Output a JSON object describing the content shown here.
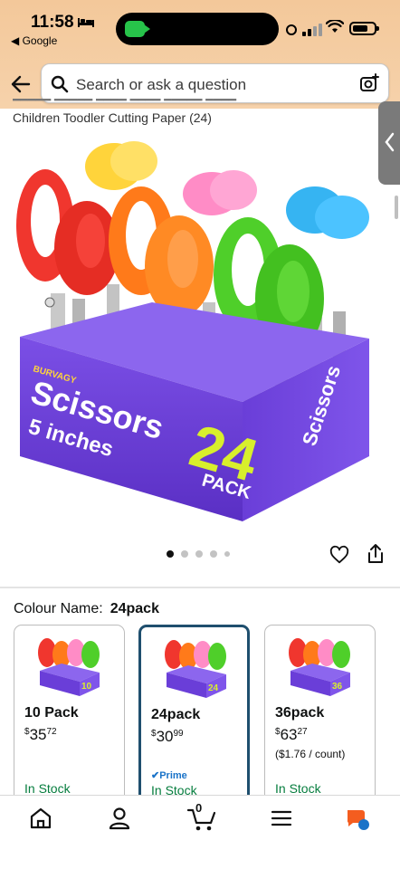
{
  "status": {
    "time": "11:58",
    "back_app": "◀ Google"
  },
  "search": {
    "placeholder": "Search or ask a question"
  },
  "product": {
    "title_partial": "Children Toodler Cutting Paper (24)",
    "image": {
      "box_brand": "BURVAGY",
      "box_title": "Scissors",
      "box_subtitle": "5 inches",
      "box_count": "24",
      "box_pack": "PACK",
      "box_side": "Scissors"
    }
  },
  "carousel": {
    "dots": 5,
    "active_index": 0
  },
  "colour": {
    "label": "Colour Name:",
    "value": "24pack"
  },
  "variants": [
    {
      "name": "10 Pack",
      "currency": "$",
      "whole": "35",
      "fraction": "72",
      "unit": "",
      "prime": "",
      "stock": "In Stock",
      "badge": "10"
    },
    {
      "name": "24pack",
      "currency": "$",
      "whole": "30",
      "fraction": "99",
      "unit": "",
      "prime": "Prime",
      "stock": "In Stock",
      "badge": "24"
    },
    {
      "name": "36pack",
      "currency": "$",
      "whole": "63",
      "fraction": "27",
      "unit": "($1.76 / count)",
      "prime": "",
      "stock": "In Stock",
      "badge": "36"
    }
  ],
  "nav": {
    "cart_count": "0"
  },
  "colors": {
    "header_band": "#f3c89a",
    "selected_border": "#1f4f6e",
    "in_stock": "#067d3e",
    "prime": "#1a73c8",
    "box_purple": "#6a3ed8"
  }
}
